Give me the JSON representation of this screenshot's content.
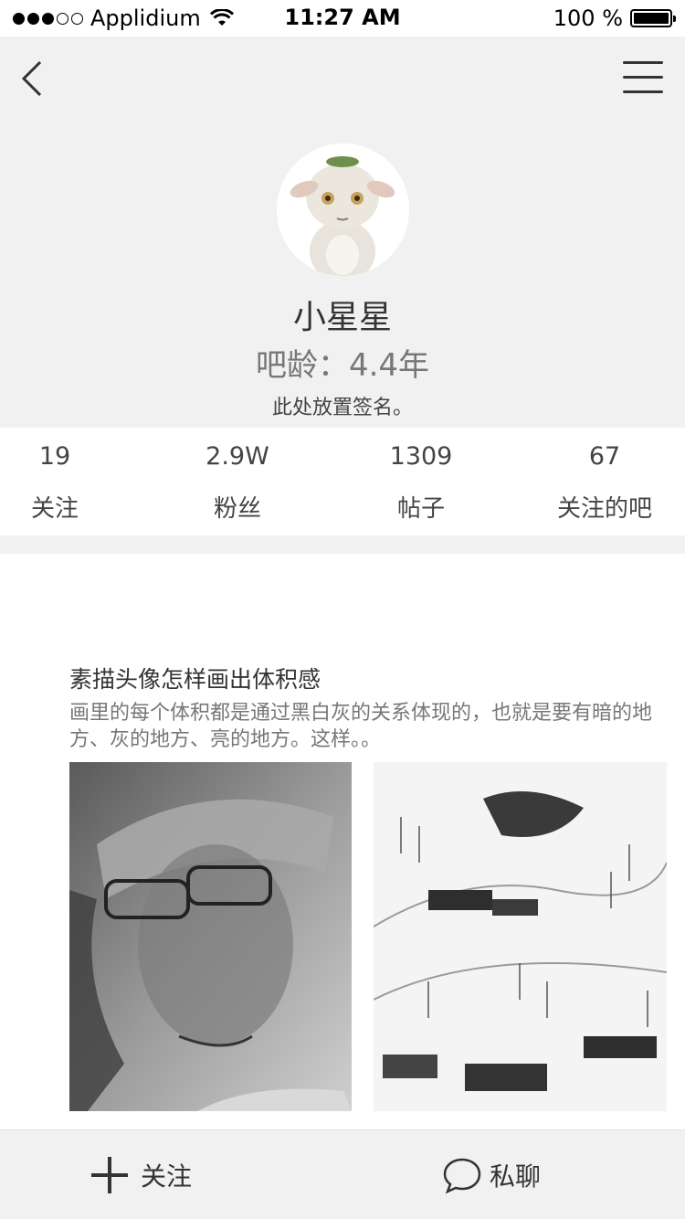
{
  "status_bar": {
    "carrier": "Applidium",
    "time": "11:27 AM",
    "battery": "100 %",
    "battery_level": 1.0
  },
  "header": {
    "back_icon": "chevron-left",
    "menu_icon": "hamburger-menu"
  },
  "profile": {
    "username": "小星星",
    "ba_age": "吧龄：4.4年",
    "signature": "此处放置签名。"
  },
  "stats": [
    {
      "value": "19",
      "label": "关注"
    },
    {
      "value": "2.9W",
      "label": "粉丝"
    },
    {
      "value": "1309",
      "label": "帖子"
    },
    {
      "value": "67",
      "label": "关注的吧"
    }
  ],
  "post": {
    "title": "素描头像怎样画出体积感",
    "excerpt": "画里的每个体积都是通过黑白灰的关系体现的，也就是要有暗的地方、灰的地方、亮的地方。这样。。"
  },
  "bottom_bar": {
    "follow_label": "关注",
    "message_label": "私聊"
  },
  "colors": {
    "background": "#f1f1f1",
    "card": "#ffffff",
    "text": "#333333",
    "muted": "#777777"
  }
}
